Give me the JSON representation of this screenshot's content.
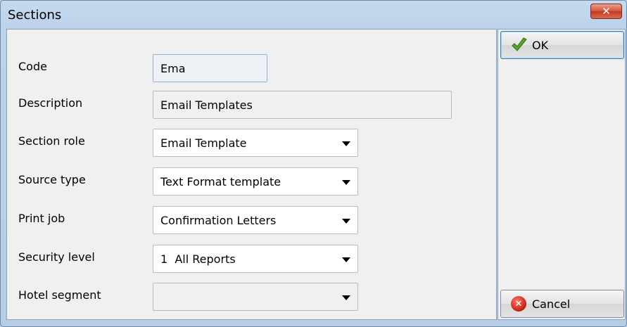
{
  "window": {
    "title": "Sections",
    "close_glyph": "✕"
  },
  "form": {
    "code": {
      "label": "Code",
      "value": "Ema"
    },
    "description": {
      "label": "Description",
      "value": "Email Templates"
    },
    "section_role": {
      "label": "Section role",
      "value": "Email Template"
    },
    "source_type": {
      "label": "Source type",
      "value": "Text Format template"
    },
    "print_job": {
      "label": "Print job",
      "value": "Confirmation Letters"
    },
    "security_level": {
      "label": "Security level",
      "value": "1  All Reports"
    },
    "hotel_segment": {
      "label": "Hotel segment",
      "value": ""
    }
  },
  "buttons": {
    "ok": {
      "label": "OK",
      "icon": "checkmark-icon"
    },
    "cancel": {
      "label": "Cancel",
      "icon": "cancel-icon"
    }
  },
  "colors": {
    "title_bg": "#bcd2ea",
    "panel_bg": "#f0f0f0",
    "close_red": "#c03b22",
    "ok_check": "#5aa42a",
    "cancel_red": "#c41e0e"
  }
}
